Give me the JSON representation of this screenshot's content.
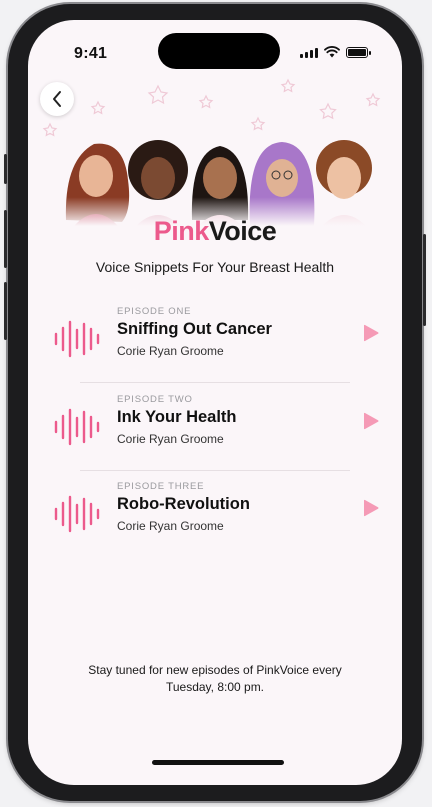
{
  "status_bar": {
    "time": "9:41"
  },
  "nav": {
    "back_label": "Back"
  },
  "app": {
    "title_part1": "Pink",
    "title_part2": "Voice",
    "subtitle": "Voice Snippets For Your Breast Health"
  },
  "episodes": [
    {
      "label": "EPISODE ONE",
      "title": "Sniffing Out Cancer",
      "author": "Corie Ryan Groome"
    },
    {
      "label": "EPISODE TWO",
      "title": "Ink Your Health",
      "author": "Corie Ryan Groome"
    },
    {
      "label": "EPISODE THREE",
      "title": "Robo-Revolution",
      "author": "Corie Ryan Groome"
    }
  ],
  "footer": {
    "line1": "Stay tuned for new episodes of PinkVoice every",
    "line2": "Tuesday, 8:00 pm."
  },
  "colors": {
    "brand_pink": "#ec5a8c",
    "text_dark": "#1a1a1a",
    "background": "#fbf6f9"
  },
  "icons": [
    "back-chevron-icon",
    "signal-icon",
    "wifi-icon",
    "battery-icon",
    "soundwave-icon",
    "play-icon"
  ]
}
